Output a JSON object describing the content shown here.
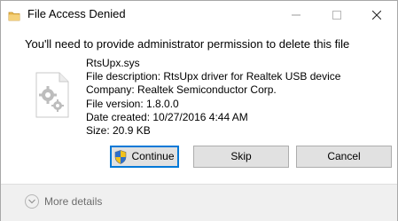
{
  "window": {
    "title": "File Access Denied"
  },
  "message": "You'll need to provide administrator permission to delete this file",
  "file": {
    "name": "RtsUpx.sys",
    "description": "File description: RtsUpx driver for Realtek USB device",
    "company": "Company: Realtek Semiconductor Corp.",
    "version": "File version: 1.8.0.0",
    "date_created": "Date created: 10/27/2016 4:44 AM",
    "size": "Size: 20.9 KB"
  },
  "buttons": {
    "continue": "Continue",
    "skip": "Skip",
    "cancel": "Cancel"
  },
  "footer": {
    "more_details": "More details"
  },
  "icons": {
    "title": "folder-icon",
    "file": "system-file-gears-icon",
    "shield": "uac-shield-icon",
    "expand": "chevron-down-icon"
  },
  "colors": {
    "accent": "#0078d7",
    "folder": "#e8b64c",
    "button_bg": "#e1e1e1",
    "footer_bg": "#f0f0f0"
  }
}
